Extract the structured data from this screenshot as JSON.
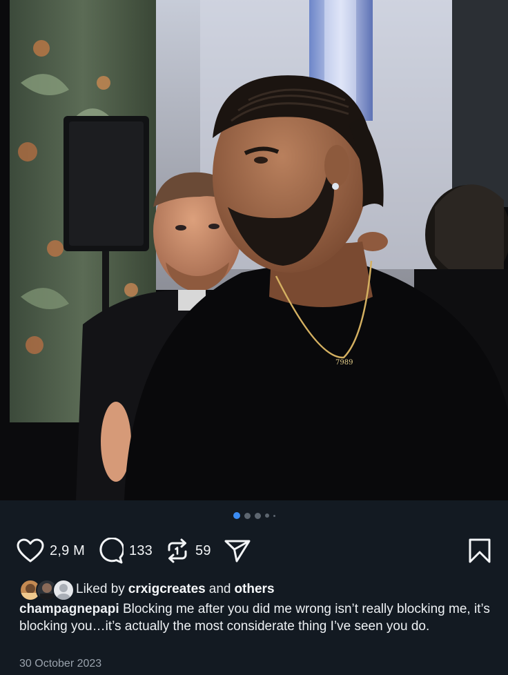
{
  "post": {
    "image_description_icon": "photo-icon",
    "carousel": {
      "count": 5,
      "active_index": 0
    },
    "actions": {
      "likes": "2,9 M",
      "comments": "133",
      "reposts": "59"
    },
    "liked_by": {
      "prefix": "Liked by",
      "user": "crxigcreates",
      "middle": "and",
      "others": "others"
    },
    "caption": {
      "username": "champagnepapi",
      "text": "Blocking me after you did me wrong isn’t really blocking me, it’s blocking you…it’s actually the most considerate thing I’ve seen you do."
    },
    "date": "30 October 2023",
    "necklace_text": "7989"
  },
  "colors": {
    "background": "#131a22",
    "accent": "#3b8cf3",
    "text": "#f3f5f7",
    "muted": "#9aa3ad"
  }
}
